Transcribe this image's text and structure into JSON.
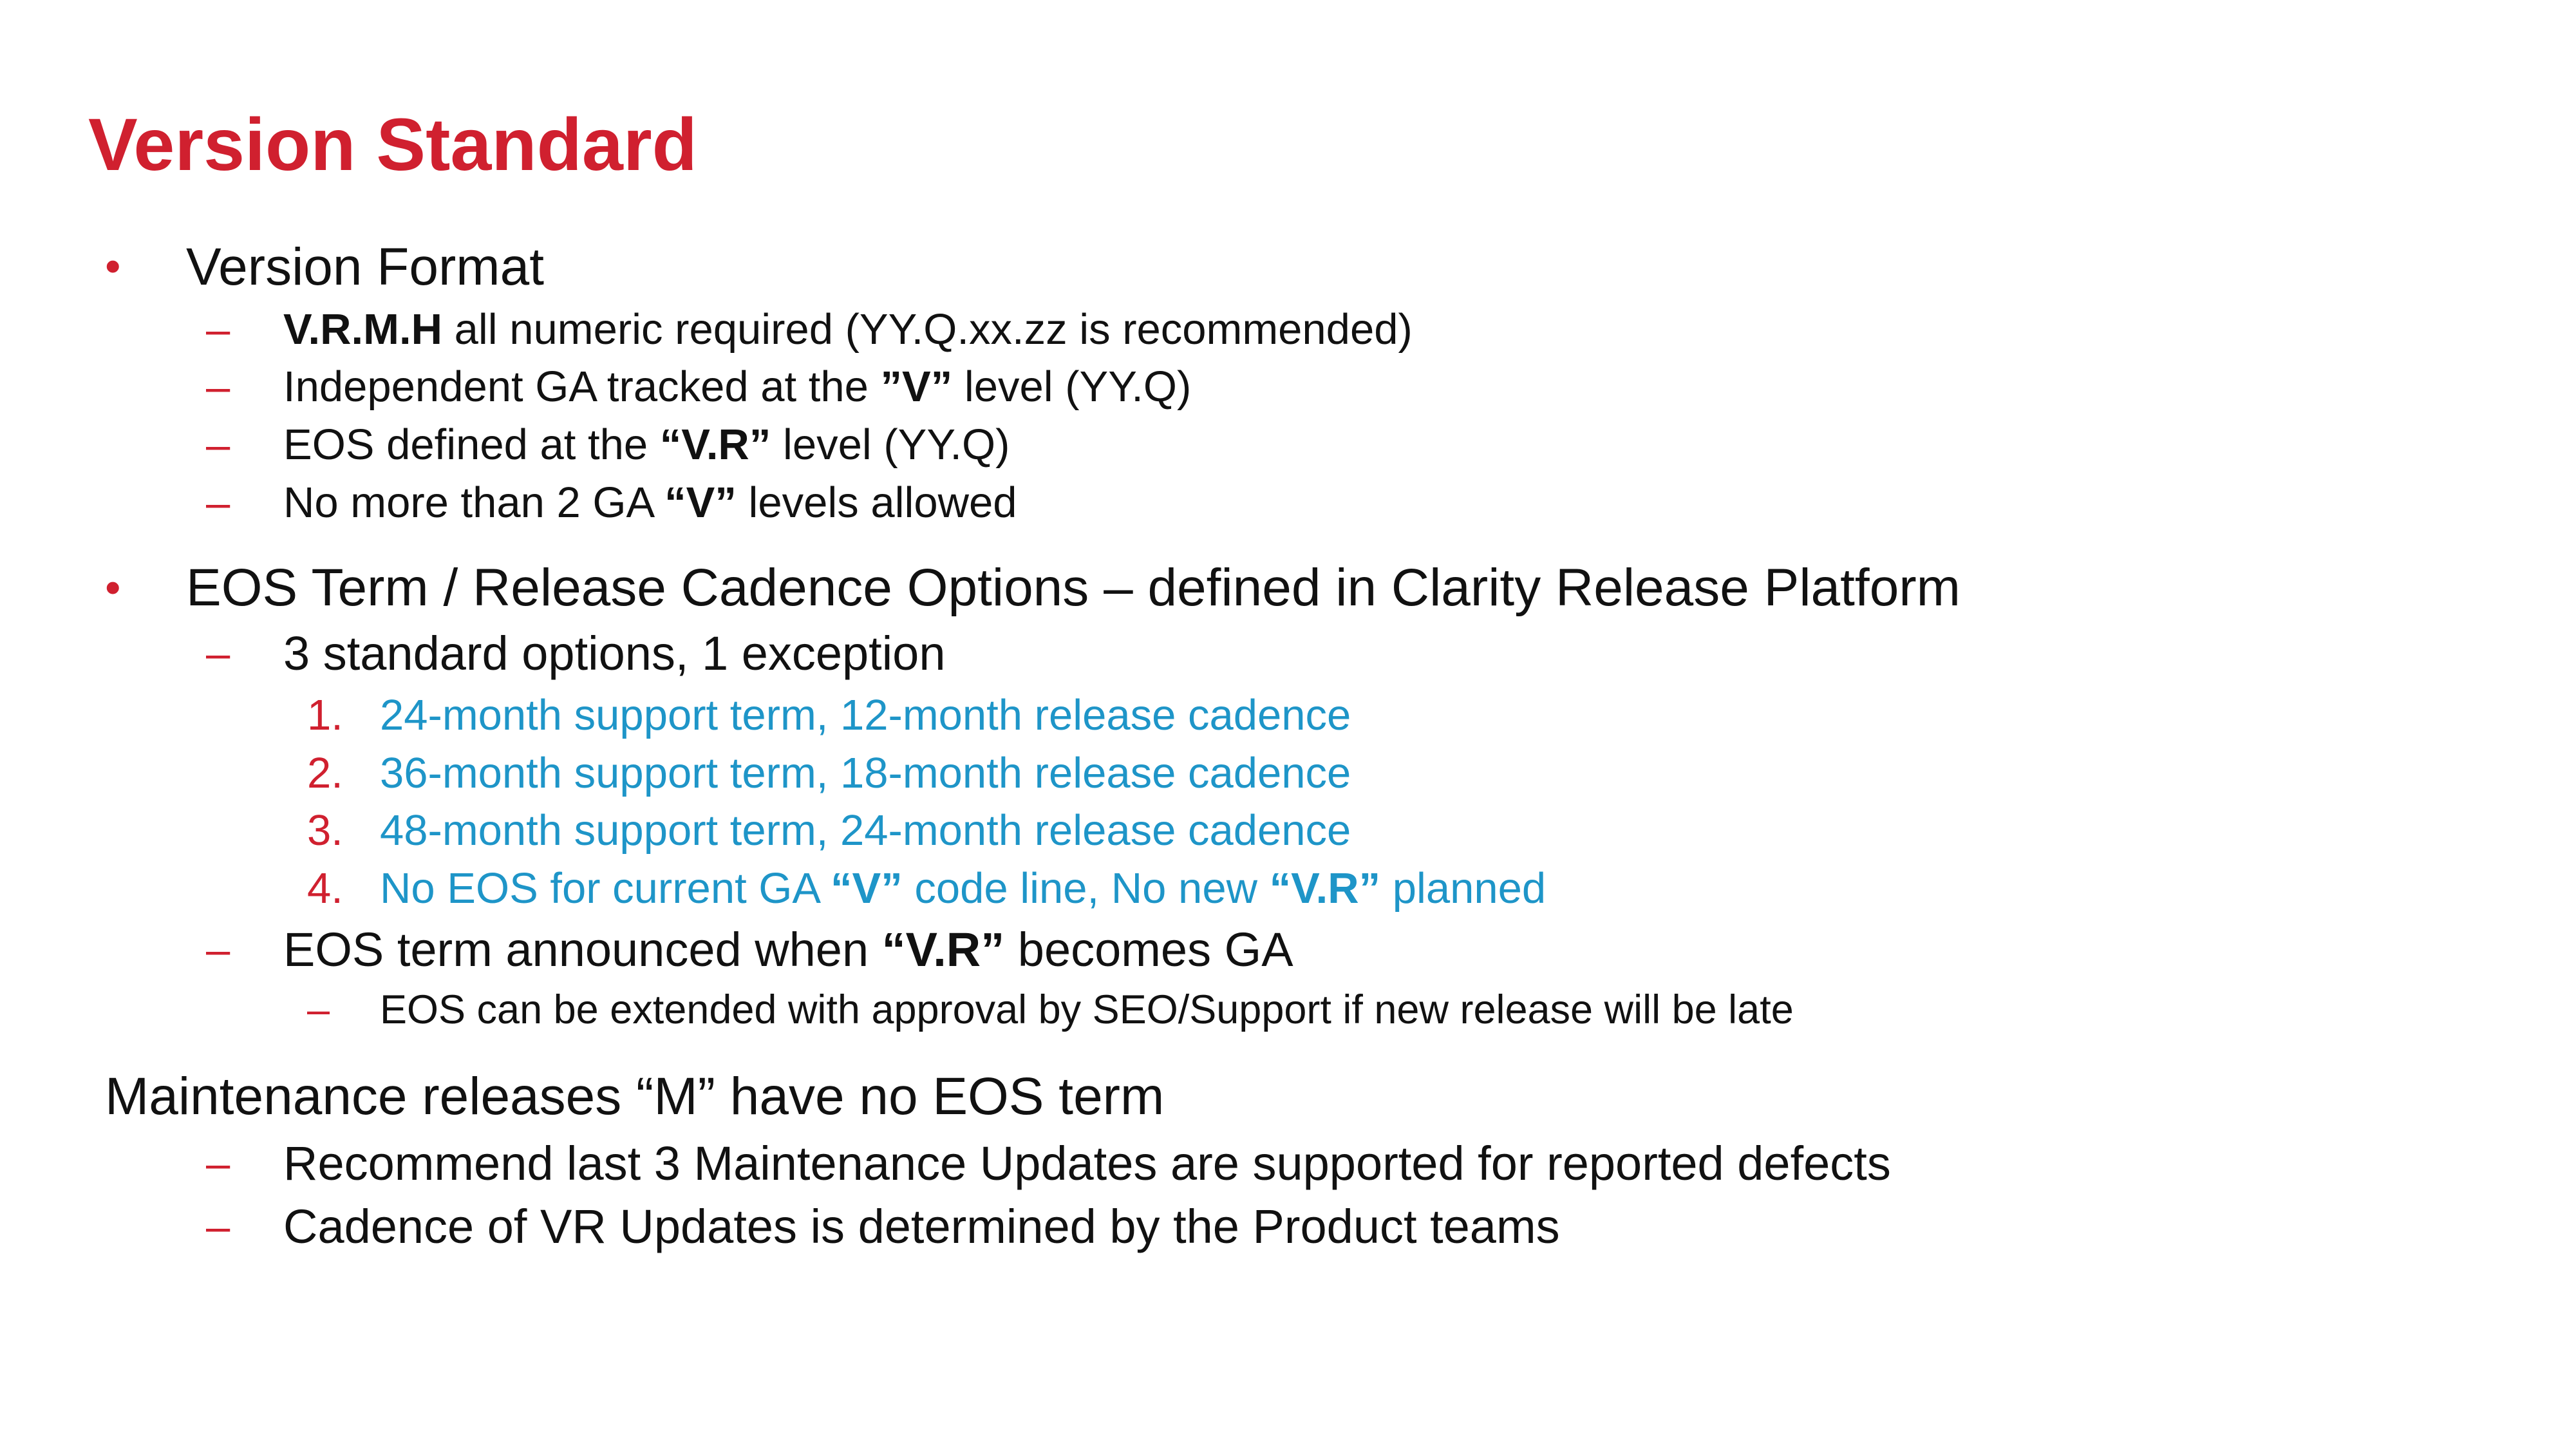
{
  "slide": {
    "title": "Version Standard",
    "bullet_glyph": "•",
    "dash_glyph": "–",
    "colors": {
      "title": "#d0202f",
      "markers": "#d0202f",
      "option_text": "#1e95c8",
      "body_text": "#111111"
    }
  },
  "sections": [
    {
      "heading": "Version Format",
      "items": [
        {
          "pre": "",
          "bold": "V.R.M.H",
          "mid": " all numeric required (YY.Q.xx.zz is recommended)",
          "bold2": "",
          "post": ""
        },
        {
          "pre": "Independent GA tracked at the ",
          "bold": "”V”",
          "mid": " level (YY.Q)",
          "bold2": "",
          "post": ""
        },
        {
          "pre": "EOS defined at the ",
          "bold": "“V.R”",
          "mid": " level (YY.Q)",
          "bold2": "",
          "post": ""
        },
        {
          "pre": "No more than 2 GA ",
          "bold": "“V”",
          "mid": " levels allowed",
          "bold2": "",
          "post": ""
        }
      ]
    },
    {
      "heading": "EOS Term / Release Cadence Options – defined in Clarity Release Platform",
      "intro": "3 standard options, 1 exception",
      "options": [
        {
          "number": "1.",
          "pre": "24-month support term, 12-month release cadence",
          "bold": "",
          "mid": "",
          "bold2": "",
          "post": ""
        },
        {
          "number": "2.",
          "pre": "36-month support term, 18-month release cadence",
          "bold": "",
          "mid": "",
          "bold2": "",
          "post": ""
        },
        {
          "number": "3.",
          "pre": "48-month support term, 24-month release cadence",
          "bold": "",
          "mid": "",
          "bold2": "",
          "post": ""
        },
        {
          "number": "4.",
          "pre": "No EOS for current GA ",
          "bold": "“V”",
          "mid": " code line, No new ",
          "bold2": "“V.R”",
          "post": " planned"
        }
      ],
      "announce": {
        "pre": "EOS term announced when ",
        "bold": "“V.R”",
        "mid": " becomes GA"
      },
      "note": "EOS can be extended with approval by SEO/Support if new release will be late"
    },
    {
      "heading": "Maintenance releases “M” have no EOS term",
      "items": [
        "Recommend last 3 Maintenance Updates are supported for reported defects",
        "Cadence of VR Updates is determined by the Product teams"
      ]
    }
  ]
}
